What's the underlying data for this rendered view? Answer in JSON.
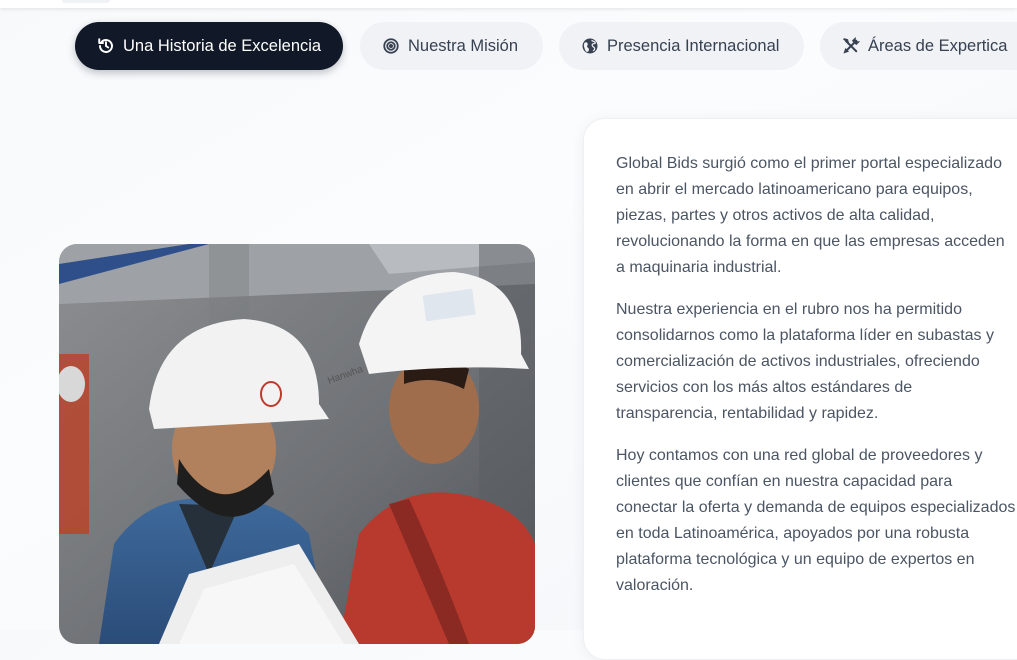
{
  "tabs": [
    {
      "label": "Una Historia de Excelencia",
      "icon": "history-icon",
      "active": true
    },
    {
      "label": "Nuestra Misión",
      "icon": "target-icon",
      "active": false
    },
    {
      "label": "Presencia Internacional",
      "icon": "globe-icon",
      "active": false
    },
    {
      "label": "Áreas de Expertica",
      "icon": "tools-icon",
      "active": false
    }
  ],
  "content": {
    "paragraphs": [
      "Global Bids surgió como el primer portal especializado en abrir el mercado latinoamericano para equipos, piezas, partes y otros activos de alta calidad, revolucionando la forma en que las empresas acceden a maquinaria industrial.",
      "Nuestra experiencia en el rubro nos ha permitido consolidarnos como la plataforma líder en subastas y comercialización de activos industriales, ofreciendo servicios con los más altos estándares de transparencia, rentabilidad y rapidez.",
      "Hoy contamos con una red global de proveedores y clientes que confían en nuestra capacidad para conectar la oferta y demanda de equipos especializados en toda Latinoamérica, apoyados por una robusta plataforma tecnológica y un equipo de expertos en valoración."
    ]
  },
  "colors": {
    "active_tab_bg": "#111827",
    "inactive_tab_bg": "#f0f2f5",
    "body_text": "#4b5563"
  }
}
